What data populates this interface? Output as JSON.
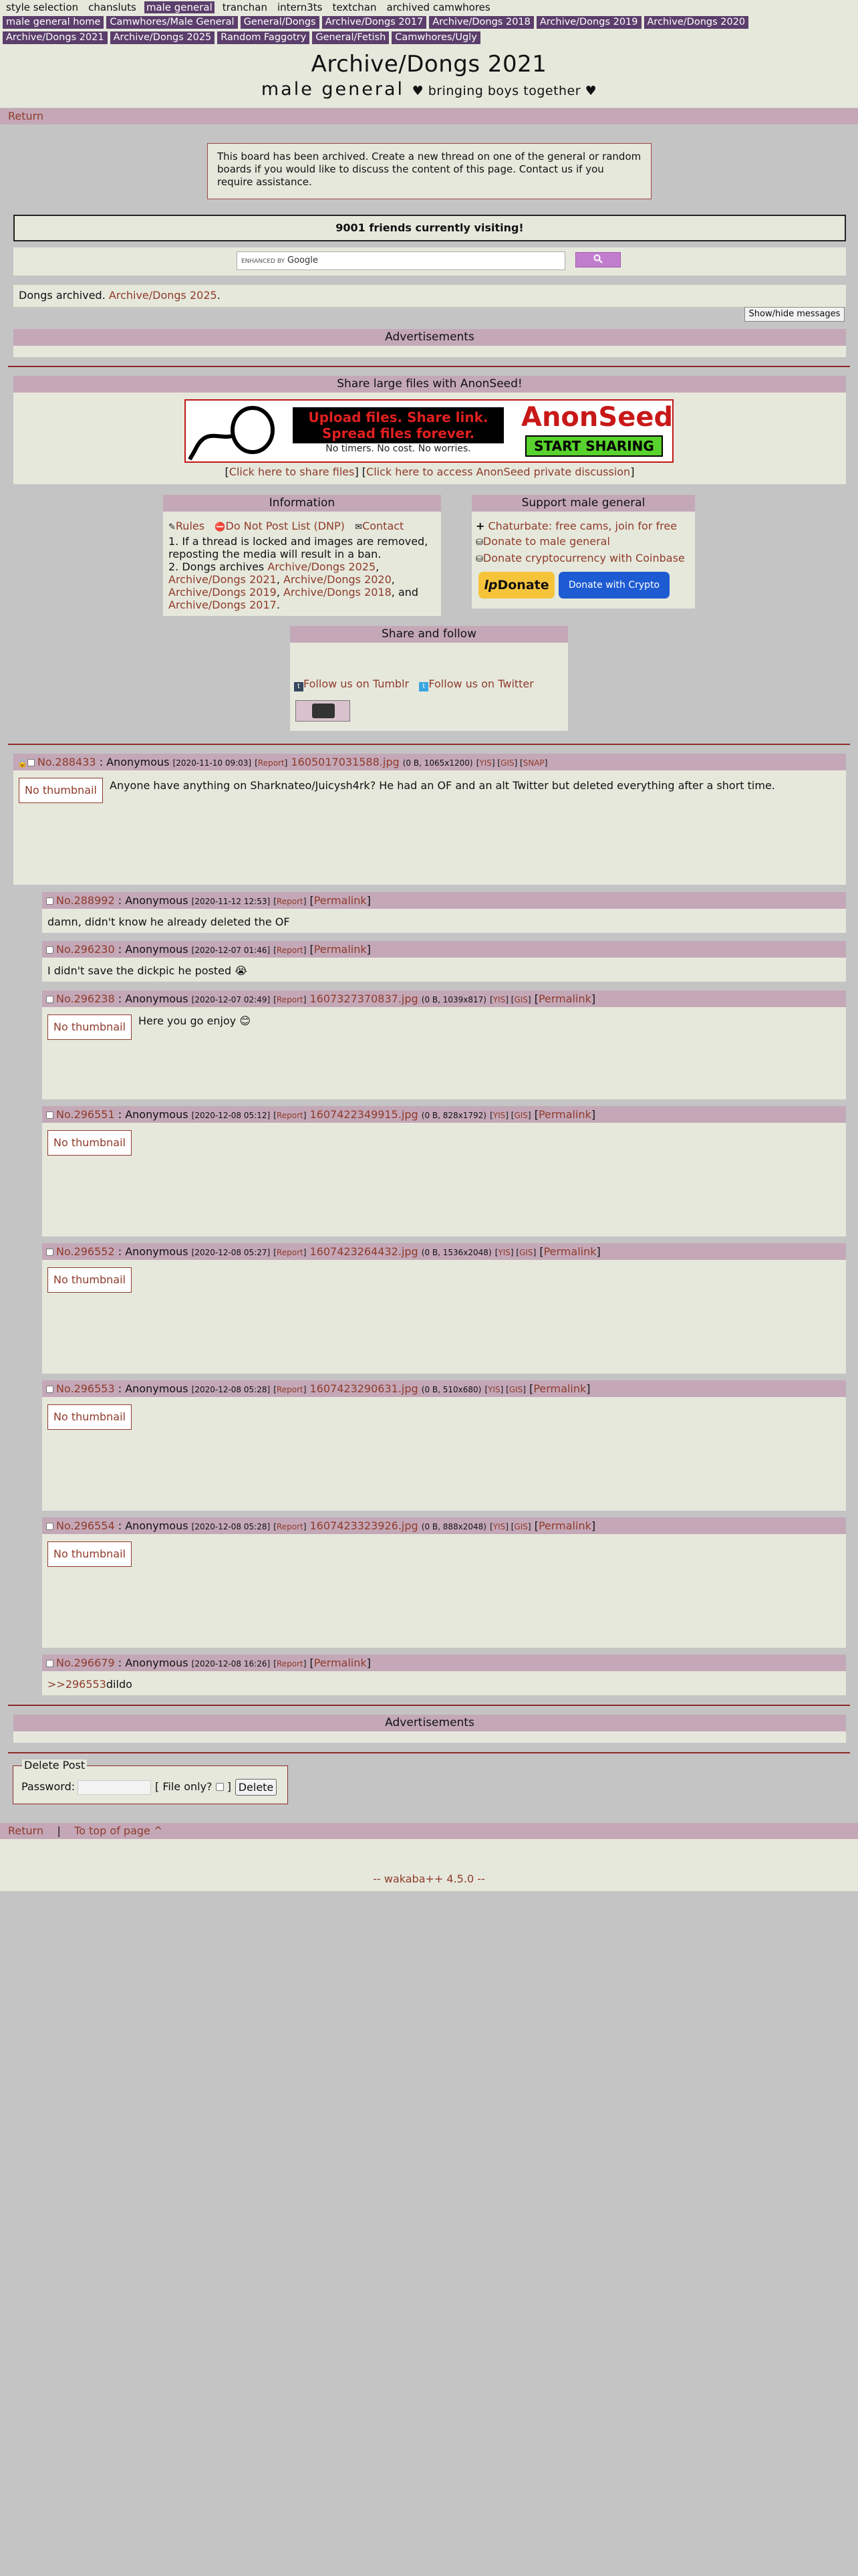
{
  "top_nav": {
    "row1": [
      "style selection",
      "chansluts",
      "male general",
      "tranchan",
      "intern3ts",
      "textchan",
      "archived camwhores"
    ],
    "row2": [
      "male general home",
      "Camwhores/Male General",
      "General/Dongs",
      "Archive/Dongs 2017",
      "Archive/Dongs 2018",
      "Archive/Dongs 2019",
      "Archive/Dongs 2020",
      "Archive/Dongs 2021",
      "Archive/Dongs 2025",
      "Random Faggotry",
      "General/Fetish",
      "Camwhores/Ugly"
    ]
  },
  "header": {
    "title": "Archive/Dongs 2021",
    "subtitle": "male general",
    "tagline": "♥ bringing boys together ♥"
  },
  "return_label": "Return",
  "notice": "This board has been archived. Create a new thread on one of the general or random boards if you would like to discuss the content of this page. Contact us if you require assistance.",
  "visiting": "9001 friends currently visiting!",
  "search": {
    "enhanced": "ENHANCED BY",
    "brand": "Google"
  },
  "archived": {
    "text": "Dongs archived.",
    "link": "Archive/Dongs 2025",
    "end": "."
  },
  "show_hide": "Show/hide messages",
  "ads_label": "Advertisements",
  "share": {
    "heading": "Share large files with AnonSeed!",
    "banner_line1": "Upload files. Share link.",
    "banner_line2": "Spread files forever.",
    "banner_sub": "No timers. No cost. No worries.",
    "brand": "AnonSeed",
    "cta": "START SHARING",
    "link1": "Click here to share files",
    "link2": "Click here to access AnonSeed private discussion"
  },
  "info": {
    "heading": "Information",
    "rules": "Rules",
    "dnp": "Do Not Post List (DNP)",
    "contact": "Contact",
    "line1": "1. If a thread is locked and images are removed, reposting the media will result in a ban.",
    "line2_prefix": "2. Dongs archives",
    "archives": [
      "Archive/Dongs 2025",
      "Archive/Dongs 2021",
      "Archive/Dongs 2020",
      "Archive/Dongs 2019",
      "Archive/Dongs 2018",
      "Archive/Dongs 2017"
    ],
    "and": "and"
  },
  "support": {
    "heading": "Support male general",
    "items": [
      "Chaturbate: free cams, join for free",
      "Donate to male general",
      "Donate cryptocurrency with Coinbase"
    ],
    "donate": "Donate",
    "crypto": "Donate with Crypto"
  },
  "share_follow": {
    "heading": "Share and follow",
    "tumblr": "Follow us on Tumblr",
    "twitter": "Follow us on Twitter"
  },
  "nothumb": "No thumbnail",
  "op": {
    "no": "No.288433",
    "sep": ":",
    "name": "Anonymous",
    "date": "[2020-11-10 09:03]",
    "report": "Report",
    "file": "1605017031588.jpg",
    "meta": "(0 B, 1065x1200)",
    "links": [
      "YIS",
      "GIS",
      "SNAP"
    ],
    "text": "Anyone have anything on Sharknateo/Juicysh4rk? He had an OF and an alt Twitter but deleted everything after a short time."
  },
  "replies": [
    {
      "no": "No.288992",
      "name": "Anonymous",
      "date": "[2020-11-12 12:53]",
      "report": "Report",
      "permalink": "Permalink",
      "text": "damn, didn't know he already deleted the OF"
    },
    {
      "no": "No.296230",
      "name": "Anonymous",
      "date": "[2020-12-07 01:46]",
      "report": "Report",
      "permalink": "Permalink",
      "text": "I didn't save the dickpic he posted 😭"
    },
    {
      "no": "No.296238",
      "name": "Anonymous",
      "date": "[2020-12-07 02:49]",
      "report": "Report",
      "file": "1607327370837.jpg",
      "meta": "(0 B, 1039x817)",
      "yis": "YIS",
      "gis": "GIS",
      "permalink": "Permalink",
      "text": "Here you go enjoy 😊"
    },
    {
      "no": "No.296551",
      "name": "Anonymous",
      "date": "[2020-12-08 05:12]",
      "report": "Report",
      "file": "1607422349915.jpg",
      "meta": "(0 B, 828x1792)",
      "yis": "YIS",
      "gis": "GIS",
      "permalink": "Permalink"
    },
    {
      "no": "No.296552",
      "name": "Anonymous",
      "date": "[2020-12-08 05:27]",
      "report": "Report",
      "file": "1607423264432.jpg",
      "meta": "(0 B, 1536x2048)",
      "yis": "YIS",
      "gis": "GIS",
      "permalink": "Permalink"
    },
    {
      "no": "No.296553",
      "name": "Anonymous",
      "date": "[2020-12-08 05:28]",
      "report": "Report",
      "file": "1607423290631.jpg",
      "meta": "(0 B, 510x680)",
      "yis": "YIS",
      "gis": "GIS",
      "permalink": "Permalink"
    },
    {
      "no": "No.296554",
      "name": "Anonymous",
      "date": "[2020-12-08 05:28]",
      "report": "Report",
      "file": "1607423323926.jpg",
      "meta": "(0 B, 888x2048)",
      "yis": "YIS",
      "gis": "GIS",
      "permalink": "Permalink"
    },
    {
      "no": "No.296679",
      "name": "Anonymous",
      "date": "[2020-12-08 16:26]",
      "report": "Report",
      "permalink": "Permalink",
      "quote": ">>296553",
      "text": "dildo"
    }
  ],
  "delete": {
    "legend": "Delete Post",
    "password_label": "Password:",
    "file_only": "[ File only?",
    "close": "]",
    "button": "Delete"
  },
  "footer": {
    "return": "Return",
    "sep": "|",
    "top": "To top of page ^",
    "powered": "-- wakaba++ 4.5.0 --"
  },
  "colors": {
    "page_bg": "#c4c4c4",
    "panel": "#e6e8dc",
    "header_bar": "#c4a8b8",
    "nav": "#5b3e6b",
    "link": "#8f3b2a",
    "rule": "#8e2a2a"
  }
}
